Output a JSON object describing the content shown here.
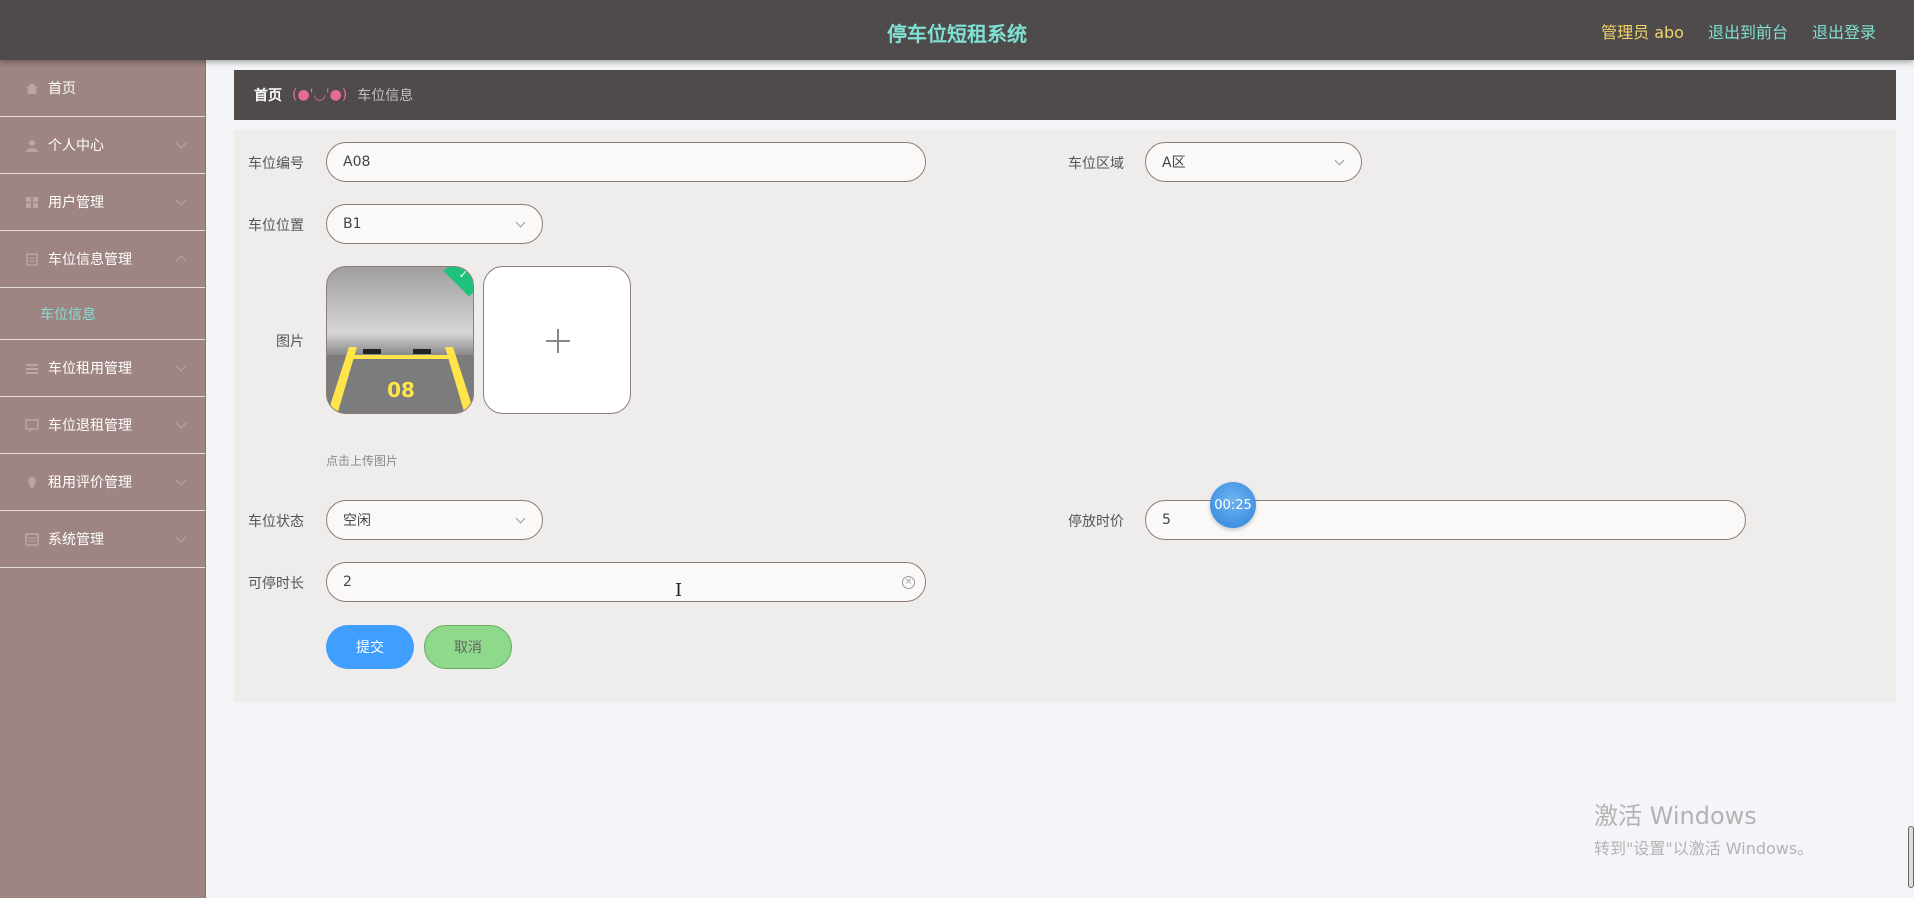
{
  "header": {
    "title": "停车位短租系统",
    "admin_label": "管理员 abo",
    "to_front": "退出到前台",
    "logout": "退出登录"
  },
  "sidebar": {
    "items": [
      {
        "label": "首页",
        "icon": "home-icon"
      },
      {
        "label": "个人中心",
        "icon": "user-icon"
      },
      {
        "label": "用户管理",
        "icon": "grid-icon"
      },
      {
        "label": "车位信息管理",
        "icon": "document-icon"
      },
      {
        "label": "车位租用管理",
        "icon": "list-icon"
      },
      {
        "label": "车位退租管理",
        "icon": "message-icon"
      },
      {
        "label": "租用评价管理",
        "icon": "location-icon"
      },
      {
        "label": "系统管理",
        "icon": "menu-icon"
      }
    ],
    "submenu_active": "车位信息"
  },
  "breadcrumb": {
    "home": "首页",
    "separator": "(●'◡'●)",
    "current": "车位信息"
  },
  "form": {
    "space_no_label": "车位编号",
    "space_no_value": "A08",
    "area_label": "车位区域",
    "area_value": "A区",
    "position_label": "车位位置",
    "position_value": "B1",
    "image_label": "图片",
    "image_caption": "08",
    "upload_hint": "点击上传图片",
    "status_label": "车位状态",
    "status_value": "空闲",
    "price_label": "停放时价",
    "price_value": "5",
    "duration_label": "可停时长",
    "duration_value": "2",
    "submit_label": "提交",
    "cancel_label": "取消"
  },
  "overlay": {
    "timer": "00:25",
    "watermark_line1": "激活 Windows",
    "watermark_line2": "转到\"设置\"以激活 Windows。"
  },
  "colors": {
    "topbar": "#504b4b",
    "sidebar": "#9e8583",
    "title": "#7fe0d3",
    "admin": "#f0d56b",
    "submit": "#409eff",
    "cancel": "#8ed98a"
  }
}
